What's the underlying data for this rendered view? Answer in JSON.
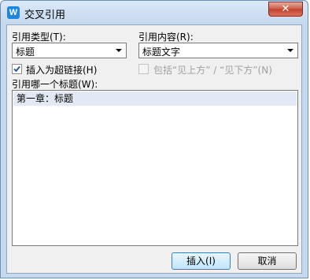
{
  "window": {
    "title": "交叉引用",
    "app_icon": "wps-writer-icon",
    "close_glyph": "✕"
  },
  "reference_type": {
    "label": "引用类型(T):",
    "value": "标题"
  },
  "reference_content": {
    "label": "引用内容(R):",
    "value": "标题文字"
  },
  "insert_hyperlink": {
    "label": "插入为超链接(H)",
    "checked": true
  },
  "include_above_below": {
    "label": "包括“见上方” / “见下方”(N)",
    "checked": false,
    "enabled": false
  },
  "headings": {
    "label": "引用哪一个标题(W):",
    "items": [
      "第一章：标题"
    ]
  },
  "buttons": {
    "insert": "插入(I)",
    "cancel": "取消"
  },
  "colors": {
    "accent": "#1d86e0",
    "close": "#c0402a",
    "selection": "#e2e9f5"
  }
}
